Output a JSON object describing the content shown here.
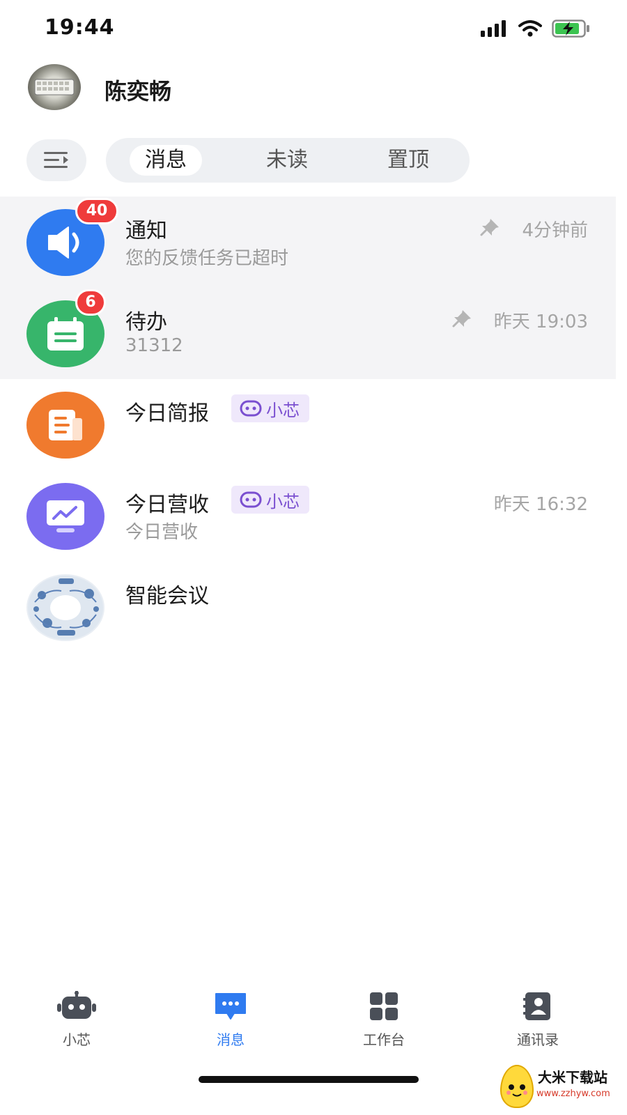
{
  "status_bar": {
    "time": "19:44"
  },
  "profile": {
    "name": "陈奕畅"
  },
  "filter": {
    "tabs": [
      {
        "label": "消息",
        "active": true
      },
      {
        "label": "未读",
        "active": false
      },
      {
        "label": "置顶",
        "active": false
      }
    ]
  },
  "chats": [
    {
      "title": "通知",
      "subtitle": "您的反馈任务已超时",
      "time": "4分钟前",
      "badge": "40",
      "pinned": true,
      "avatar_icon": "speaker-icon",
      "avatar_color": "#2f7bf0"
    },
    {
      "title": "待办",
      "subtitle": "31312",
      "time": "昨天 19:03",
      "badge": "6",
      "pinned": true,
      "avatar_icon": "calendar-icon",
      "avatar_color": "#37b56b"
    },
    {
      "title": "今日简报",
      "tag": "小芯",
      "subtitle": "",
      "time": "",
      "pinned": false,
      "avatar_icon": "document-icon",
      "avatar_color": "#f07a2e"
    },
    {
      "title": "今日营收",
      "tag": "小芯",
      "subtitle": "今日营收",
      "time": "昨天 16:32",
      "pinned": false,
      "avatar_icon": "chart-monitor-icon",
      "avatar_color": "#7b6cf0"
    },
    {
      "title": "智能会议",
      "subtitle": "",
      "time": "",
      "pinned": false,
      "avatar_icon": "meeting-image"
    }
  ],
  "tabbar": {
    "items": [
      {
        "label": "小芯",
        "icon": "robot-icon",
        "active": false
      },
      {
        "label": "消息",
        "icon": "message-icon",
        "active": true
      },
      {
        "label": "工作台",
        "icon": "grid-icon",
        "active": false
      },
      {
        "label": "通讯录",
        "icon": "contacts-icon",
        "active": false
      }
    ]
  },
  "watermark": {
    "title": "大米下载站",
    "url": "www.zzhyw.com"
  },
  "colors": {
    "accent": "#2f7bf0",
    "badge": "#ef3b3b",
    "tag_bg": "#efe8fb",
    "tag_text": "#7a4fd0"
  }
}
